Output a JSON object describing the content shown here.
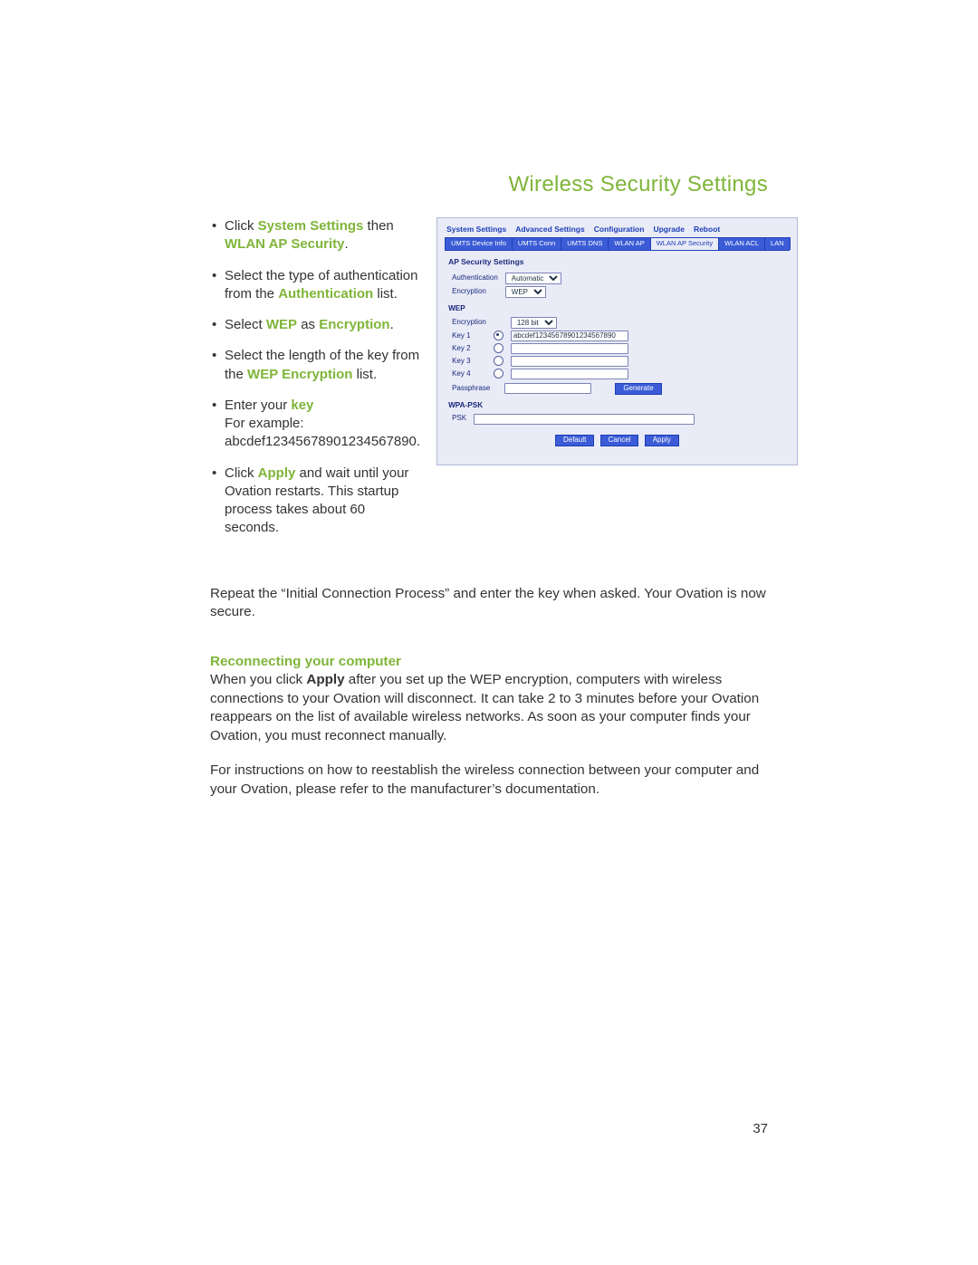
{
  "page_number": "37",
  "title": "Wireless Security Settings",
  "steps": [
    {
      "pre": "Click ",
      "hl1": "System Settings",
      "mid": " then ",
      "hl2": "WLAN AP Security",
      "post": "."
    },
    {
      "pre": "Select the type of authentication from the ",
      "hl1": "Authentication",
      "post": " list."
    },
    {
      "pre": "Select ",
      "hl1": "WEP",
      "mid": " as ",
      "hl2": "Encryption",
      "post": "."
    },
    {
      "pre": "Select the length of the key from the ",
      "hl1": "WEP Encryption",
      "post": " list."
    },
    {
      "pre": "Enter your ",
      "hl1": "key",
      "br": true,
      "after1": "For example:",
      "after2": "abcdef12345678901234567890."
    },
    {
      "pre": "Click ",
      "hl1": "Apply",
      "post": " and wait until your Ovation restarts. This startup process takes about 60 seconds."
    }
  ],
  "figure": {
    "topnav": [
      "System Settings",
      "Advanced Settings",
      "Configuration",
      "Upgrade",
      "Reboot"
    ],
    "tabs": [
      "UMTS Device Info",
      "UMTS Conn",
      "UMTS DNS",
      "WLAN AP",
      "WLAN AP Security",
      "WLAN ACL",
      "LAN"
    ],
    "active_tab_index": 4,
    "panel_title": "AP Security Settings",
    "authentication_label": "Authentication",
    "authentication_value": "Automatic",
    "enc_label": "Encryption",
    "enc_value": "WEP",
    "wep_section": "WEP",
    "wep_enc_label": "Encryption",
    "wep_enc_value": "128 bit",
    "keys": [
      {
        "label": "Key 1",
        "checked": true,
        "value": "abcdef12345678901234567890"
      },
      {
        "label": "Key 2",
        "checked": false,
        "value": ""
      },
      {
        "label": "Key 3",
        "checked": false,
        "value": ""
      },
      {
        "label": "Key 4",
        "checked": false,
        "value": ""
      }
    ],
    "passphrase_label": "Passphrase",
    "passphrase_value": "",
    "generate_label": "Generate",
    "wpa_section": "WPA-PSK",
    "psk_label": "PSK",
    "psk_value": "",
    "buttons": {
      "default": "Default",
      "cancel": "Cancel",
      "apply": "Apply"
    }
  },
  "body": {
    "para1": "Repeat the “Initial Connection Process” and enter the key when asked. Your Ovation is now secure.",
    "subhead": "Reconnecting your computer",
    "para2_pre": "When you click ",
    "para2_bold": "Apply",
    "para2_post": " after you set up the WEP encryption, computers with wireless connections to your Ovation will disconnect. It can take 2 to 3 minutes before your Ovation reappears on the list of available wireless networks. As soon as your computer finds your Ovation, you must reconnect manually.",
    "para3": "For instructions on how to reestablish the wireless connection between your computer and your Ovation, please refer to the manufacturer’s documentation."
  }
}
